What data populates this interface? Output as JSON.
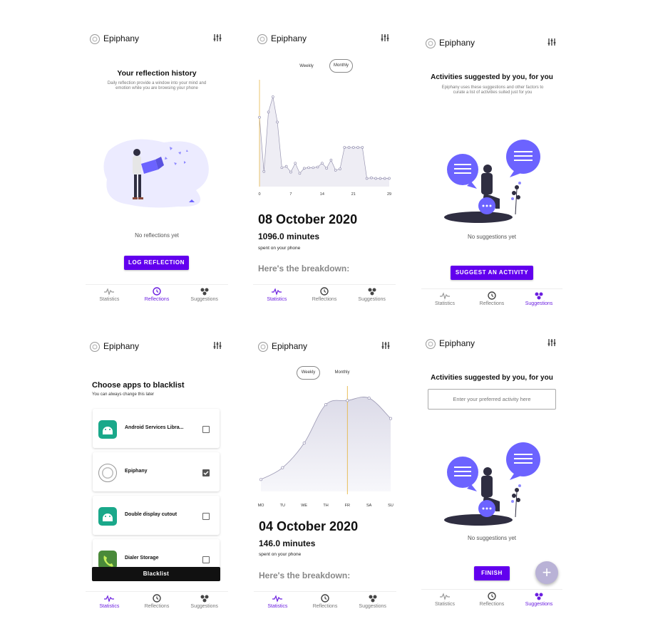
{
  "app": {
    "title": "Epiphany"
  },
  "nav": {
    "statistics": "Statistics",
    "reflections": "Reflections",
    "suggestions": "Suggestions"
  },
  "colors": {
    "primary": "#6200ee",
    "accent_line": "#e6b84a",
    "illustration": "#6c63ff"
  },
  "screen1": {
    "title": "Your reflection history",
    "subtitle": "Daily reflection provide a window into your mind and emotion while you are browsing your phone",
    "empty": "No reflections yet",
    "button": "LOG REFLECTION"
  },
  "screen2": {
    "toggle_weekly": "Weekly",
    "toggle_monthly": "Monthly",
    "selected": "Monthly",
    "date": "08 October 2020",
    "minutes": "1096.0 minutes",
    "spent": "spent on your phone",
    "breakdown": "Here's the breakdown:"
  },
  "screen3": {
    "title": "Activities suggested by you, for you",
    "subtitle": "Epiphany uses these suggestions and other factors to curate a list of activities suited just for you",
    "empty": "No suggestions yet",
    "button": "SUGGEST AN ACTIVITY"
  },
  "screen4": {
    "title": "Choose apps to blacklist",
    "subtitle": "You can always change this later",
    "apps": [
      {
        "name": "Android Services Libra...",
        "checked": false,
        "icon": "android-icon"
      },
      {
        "name": "Epiphany",
        "checked": true,
        "icon": "epiphany-logo-icon"
      },
      {
        "name": "Double display cutout",
        "checked": false,
        "icon": "android-icon"
      },
      {
        "name": "Dialer Storage",
        "checked": false,
        "icon": "phone-icon"
      }
    ],
    "button": "Blacklist"
  },
  "screen5": {
    "toggle_weekly": "Weekly",
    "toggle_monthly": "Monthly",
    "selected": "Weekly",
    "date": "04 October 2020",
    "minutes": "146.0 minutes",
    "spent": "spent on your phone",
    "breakdown": "Here's the breakdown:"
  },
  "screen6": {
    "title": "Activities suggested by you, for you",
    "input_placeholder": "Enter your preferred activity here",
    "empty": "No suggestions yet",
    "button": "FINISH",
    "fab": "+"
  },
  "chart_data": [
    {
      "type": "area",
      "x_ticks": [
        "0",
        "7",
        "14",
        "21",
        "29"
      ],
      "x": [
        0,
        1,
        2,
        3,
        4,
        5,
        6,
        7,
        8,
        9,
        10,
        11,
        12,
        13,
        14,
        15,
        16,
        17,
        18,
        19,
        20,
        21,
        22,
        23,
        24,
        25,
        26,
        27,
        28,
        29
      ],
      "values": [
        1096,
        240,
        1180,
        1420,
        1020,
        300,
        320,
        230,
        370,
        210,
        290,
        300,
        300,
        310,
        370,
        290,
        420,
        260,
        280,
        620,
        620,
        620,
        620,
        620,
        130,
        140,
        130,
        130,
        130,
        130
      ],
      "highlight_x": 0
    },
    {
      "type": "area",
      "categories": [
        "MO",
        "TU",
        "WE",
        "TH",
        "FR",
        "SA",
        "SU"
      ],
      "values": [
        146,
        290,
        590,
        1060,
        1110,
        1140,
        890
      ],
      "highlight": "FR"
    }
  ]
}
